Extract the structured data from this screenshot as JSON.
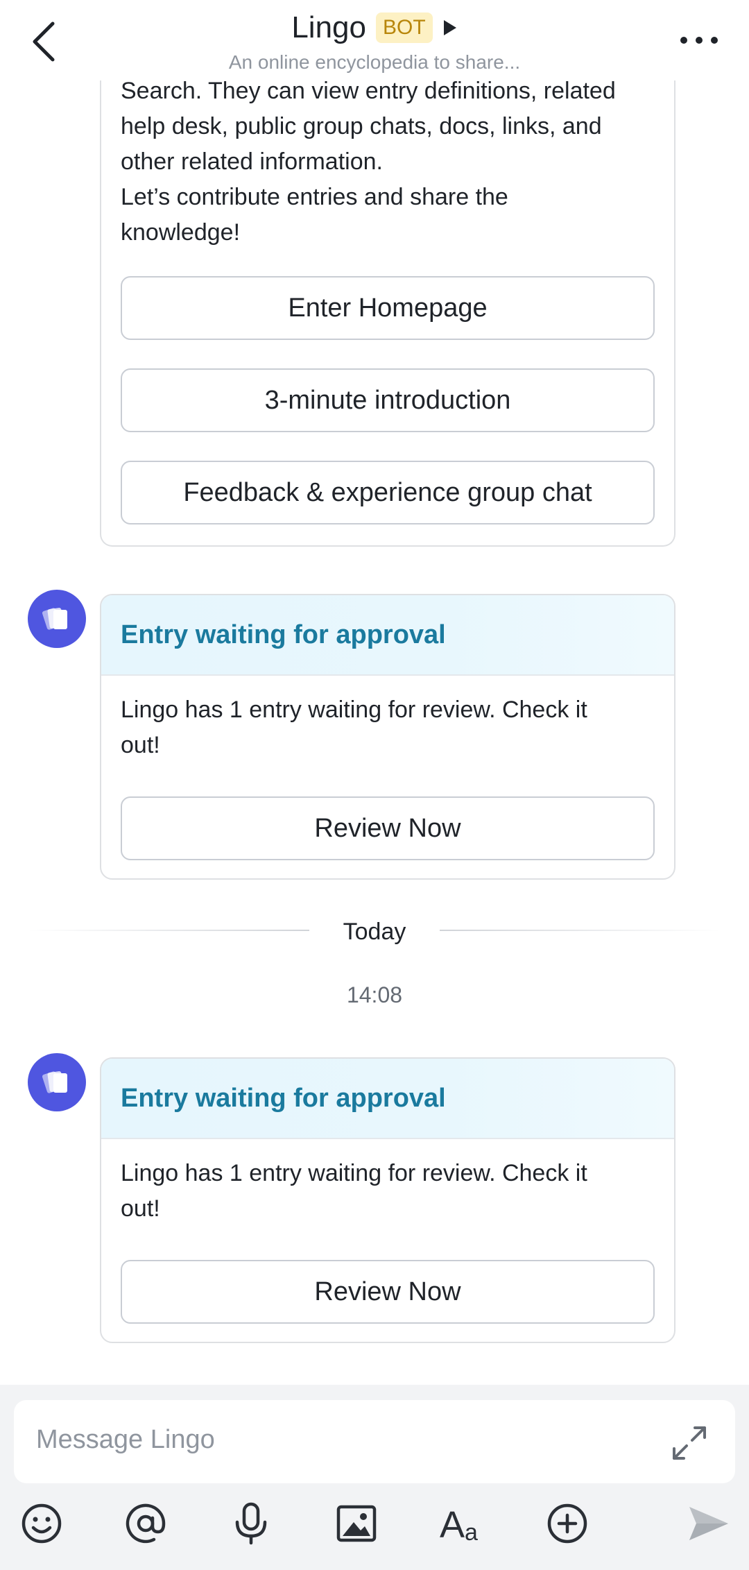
{
  "header": {
    "title": "Lingo",
    "badge": "BOT",
    "subtitle": "An online encyclopedia to share..."
  },
  "intro_card": {
    "text_lines": [
      "Search. They can view entry definitions, related",
      "help desk, public group chats, docs, links, and",
      "other related information.",
      "Let’s contribute entries and share the",
      "knowledge!"
    ],
    "buttons": [
      "Enter Homepage",
      "3-minute introduction",
      "Feedback & experience group chat"
    ]
  },
  "approval_cards": [
    {
      "title": "Entry waiting for approval",
      "body_line1": "Lingo has 1 entry waiting for review. Check it",
      "body_line2": "out!",
      "button": "Review Now"
    },
    {
      "title": "Entry waiting for approval",
      "body_line1": "Lingo has 1 entry waiting for review. Check it",
      "body_line2": "out!",
      "button": "Review Now"
    }
  ],
  "separator": {
    "day": "Today",
    "time": "14:08"
  },
  "composer": {
    "placeholder": "Message Lingo",
    "toolbar": [
      "emoji-icon",
      "mention-icon",
      "microphone-icon",
      "image-icon",
      "text-format-icon",
      "add-icon",
      "send-icon"
    ]
  },
  "colors": {
    "avatar": "#4f56e0",
    "card_title": "#1a7a9e",
    "badge_bg": "#fdf1c4",
    "badge_text": "#b8860b"
  }
}
